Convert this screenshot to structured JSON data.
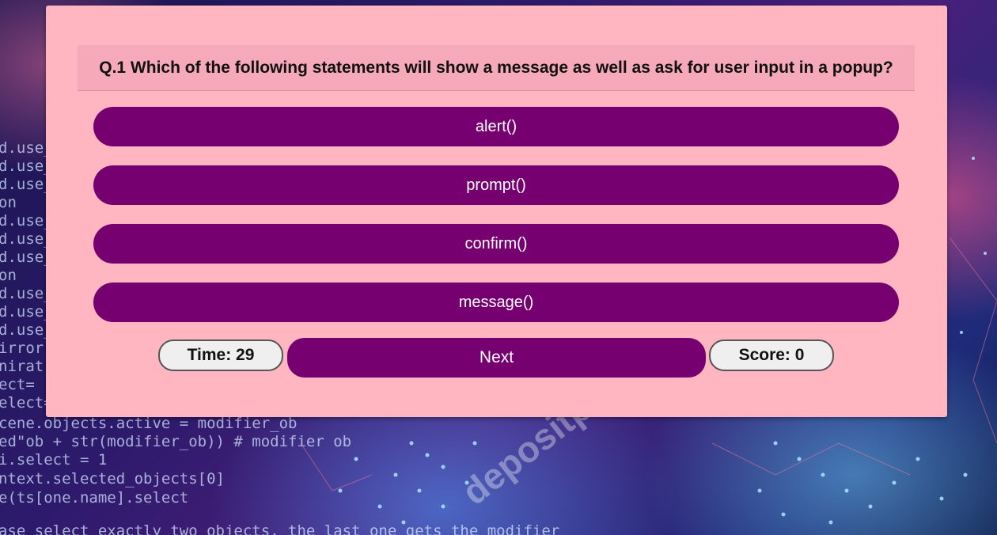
{
  "background": {
    "code_lines_left": [
      "d.use_",
      "d.use_",
      "d.use_",
      "on",
      "d.use_",
      "d.use_",
      "d.use_",
      "on",
      "d.use_",
      "d.use_",
      "d.use_",
      "irror",
      "nirat",
      "ect=",
      "elect="
    ],
    "code_lines_bottom": [
      "cene.objects.active = modifier_ob",
      "ed\"ob + str(modifier_ob)) # modifier ob",
      "i.select = 1",
      "ntext.selected_objects[0]",
      "e(ts[one.name].select",
      "ase select exactly two objects, the last one gets the modifier"
    ],
    "watermark": "depositphotos",
    "colors": {
      "top": "#2c1a6b",
      "accent_pink": "#ff5a8c",
      "accent_blue": "#50a0ff"
    }
  },
  "quiz": {
    "question": "Q.1 Which of the following statements will show a message as well as ask for user input in a popup?",
    "options": [
      "alert()",
      "prompt()",
      "confirm()",
      "message()"
    ],
    "time_label": "Time: 29",
    "next_label": "Next",
    "score_label": "Score: 0",
    "colors": {
      "card_bg": "#ffb6c1",
      "question_bg": "#f6a9b8",
      "button_bg": "#760070",
      "pill_bg": "#efefef"
    }
  }
}
